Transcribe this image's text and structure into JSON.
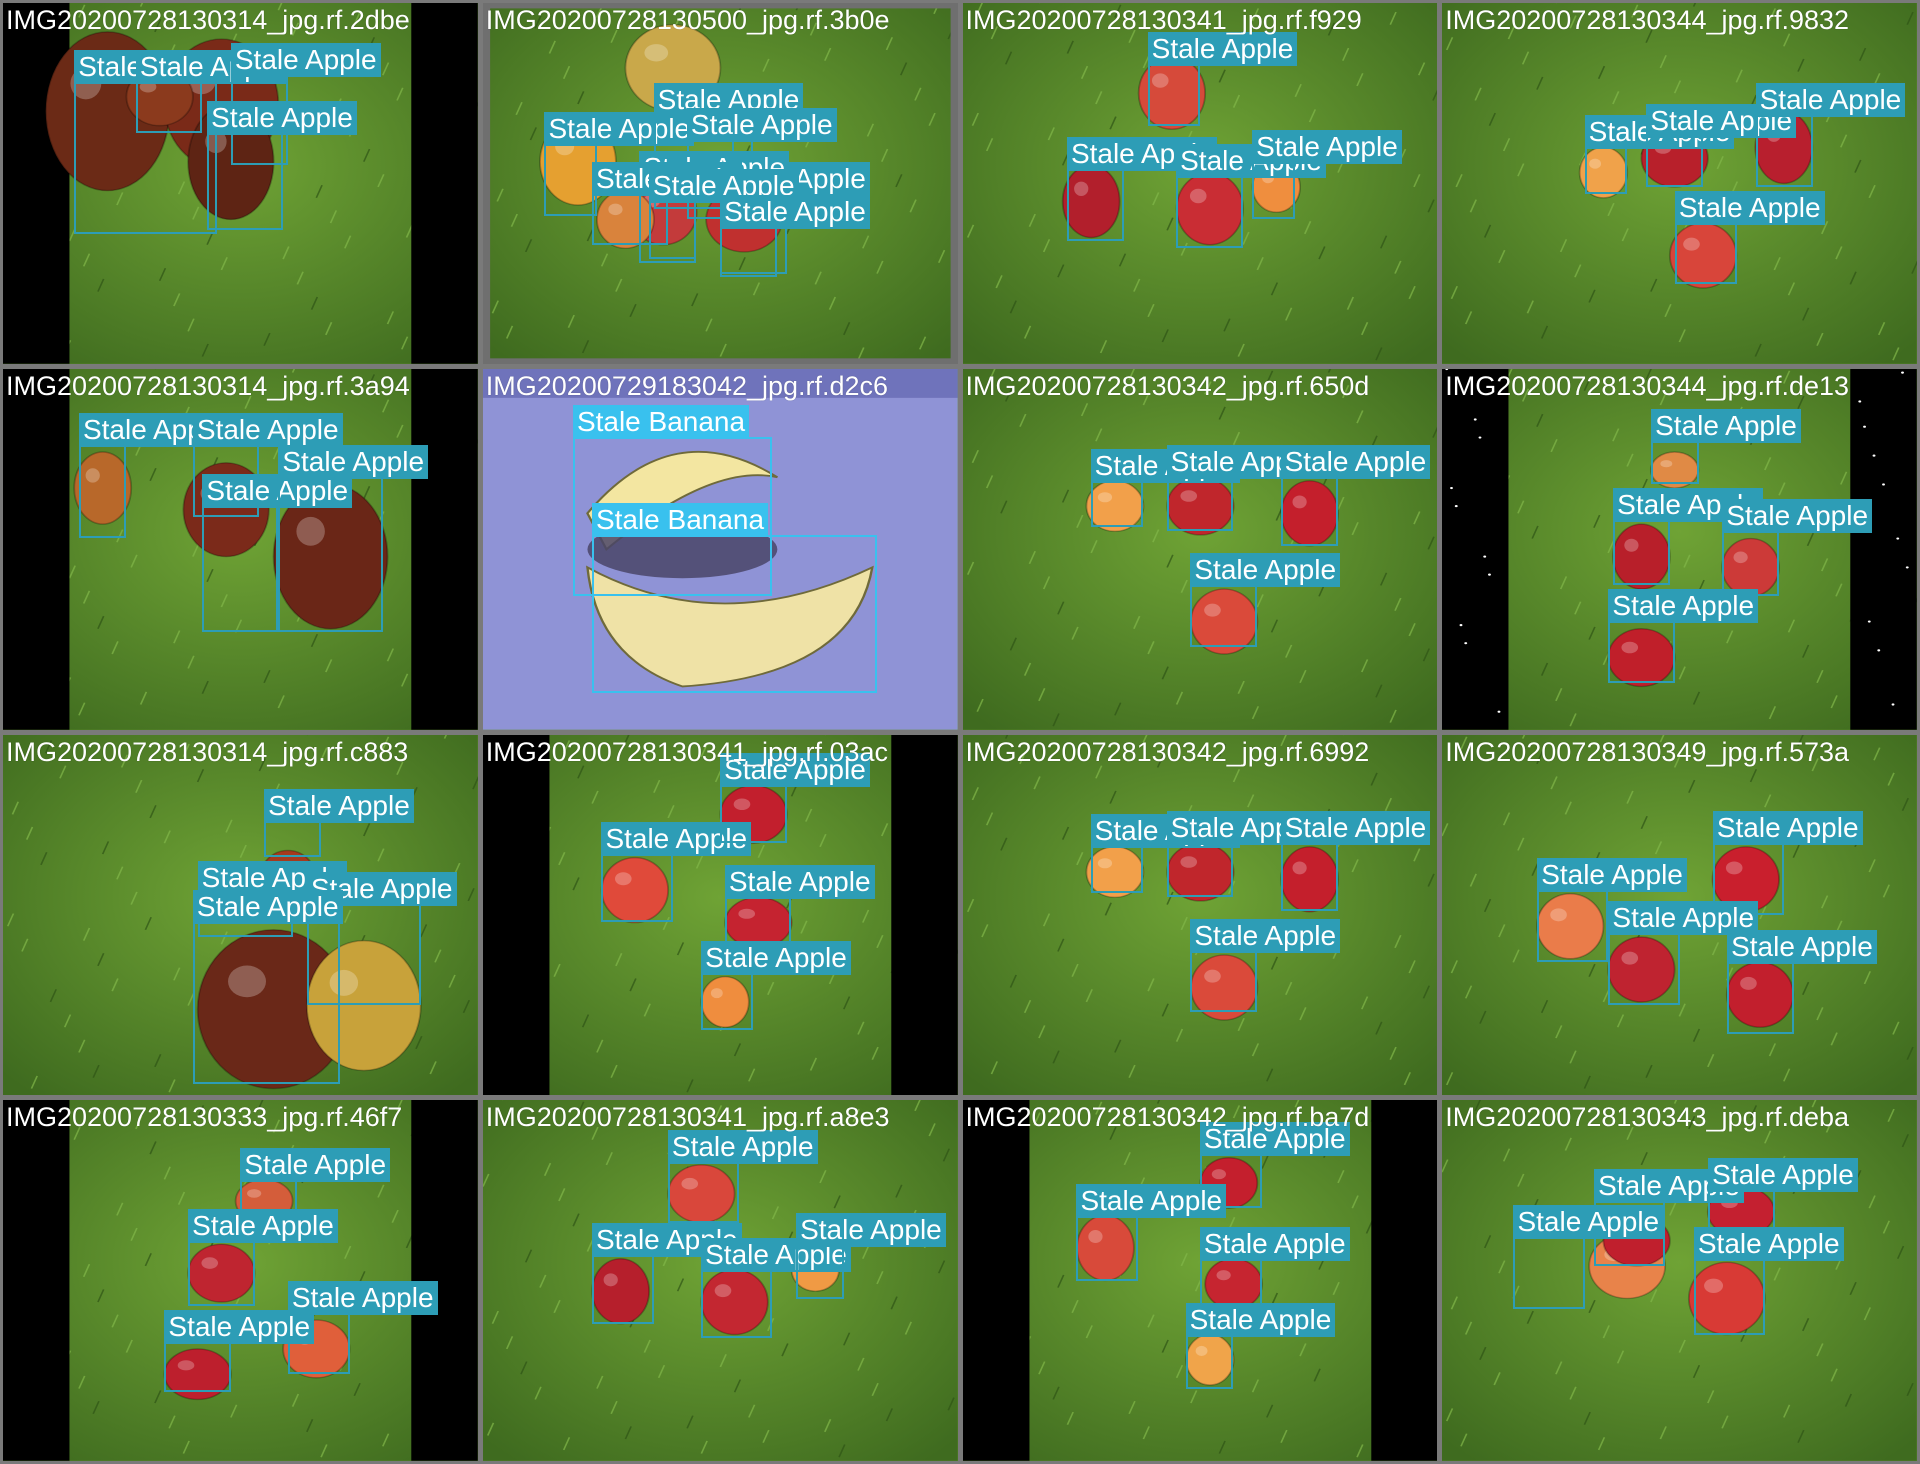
{
  "colors": {
    "frame_bg": "#7a7a7a",
    "apple_box": "#2d9db6",
    "banana_box": "#39c1ee",
    "grass": "#5e8f2a",
    "label_text": "#ffffff"
  },
  "grid": {
    "rows": 4,
    "cols": 4
  },
  "tiles": [
    {
      "filename": "IMG20200728130314_jpg.rf.2dbe",
      "scene": "grass-bars",
      "detections": [
        {
          "label": "Stale Apple",
          "kind": "apple"
        },
        {
          "label": "Stale Apple",
          "kind": "apple"
        },
        {
          "label": "Stale Apple",
          "kind": "apple"
        },
        {
          "label": "Stale Apple",
          "kind": "apple"
        }
      ]
    },
    {
      "filename": "IMG20200728130500_jpg.rf.3b0e",
      "scene": "grass-fisheye",
      "detections": [
        {
          "label": "Stale Apple",
          "kind": "apple"
        },
        {
          "label": "Stale Apple",
          "kind": "apple"
        },
        {
          "label": "Stale Apple",
          "kind": "apple"
        },
        {
          "label": "Stale Apple",
          "kind": "apple"
        },
        {
          "label": "Stale Apple",
          "kind": "apple"
        },
        {
          "label": "Stale Apple",
          "kind": "apple"
        },
        {
          "label": "Stale Apple",
          "kind": "apple"
        },
        {
          "label": "Stale Apple",
          "kind": "apple"
        }
      ]
    },
    {
      "filename": "IMG20200728130341_jpg.rf.f929",
      "scene": "grass",
      "detections": [
        {
          "label": "Stale Apple",
          "kind": "apple"
        },
        {
          "label": "Stale Apple",
          "kind": "apple"
        },
        {
          "label": "Stale Apple",
          "kind": "apple"
        },
        {
          "label": "Stale Apple",
          "kind": "apple"
        }
      ]
    },
    {
      "filename": "IMG20200728130344_jpg.rf.9832",
      "scene": "grass",
      "detections": [
        {
          "label": "Stale Apple",
          "kind": "apple"
        },
        {
          "label": "Stale Apple",
          "kind": "apple"
        },
        {
          "label": "Stale Apple",
          "kind": "apple"
        },
        {
          "label": "Stale Apple",
          "kind": "apple"
        }
      ]
    },
    {
      "filename": "IMG20200728130314_jpg.rf.3a94",
      "scene": "grass-bars",
      "detections": [
        {
          "label": "Stale Apple",
          "kind": "apple"
        },
        {
          "label": "Stale Apple",
          "kind": "apple"
        },
        {
          "label": "Stale Apple",
          "kind": "apple"
        },
        {
          "label": "Stale Apple",
          "kind": "apple"
        }
      ]
    },
    {
      "filename": "IMG20200729183042_jpg.rf.d2c6",
      "scene": "blue",
      "detections": [
        {
          "label": "Stale Banana",
          "kind": "banana"
        },
        {
          "label": "Stale Banana",
          "kind": "banana"
        }
      ]
    },
    {
      "filename": "IMG20200728130342_jpg.rf.650d",
      "scene": "grass",
      "detections": [
        {
          "label": "Stale Apple",
          "kind": "apple"
        },
        {
          "label": "Stale Apple",
          "kind": "apple"
        },
        {
          "label": "Stale Apple",
          "kind": "apple"
        },
        {
          "label": "Stale Apple",
          "kind": "apple"
        }
      ]
    },
    {
      "filename": "IMG20200728130344_jpg.rf.de13",
      "scene": "grass-bars-dark",
      "detections": [
        {
          "label": "Stale Apple",
          "kind": "apple"
        },
        {
          "label": "Stale Apple",
          "kind": "apple"
        },
        {
          "label": "Stale Apple",
          "kind": "apple"
        },
        {
          "label": "Stale Apple",
          "kind": "apple"
        }
      ]
    },
    {
      "filename": "IMG20200728130314_jpg.rf.c883",
      "scene": "grass",
      "detections": [
        {
          "label": "Stale Apple",
          "kind": "apple"
        },
        {
          "label": "Stale Apple",
          "kind": "apple"
        },
        {
          "label": "Stale Apple",
          "kind": "apple"
        },
        {
          "label": "Stale Apple",
          "kind": "apple"
        }
      ]
    },
    {
      "filename": "IMG20200728130341_jpg.rf.03ac",
      "scene": "grass-bars",
      "detections": [
        {
          "label": "Stale Apple",
          "kind": "apple"
        },
        {
          "label": "Stale Apple",
          "kind": "apple"
        },
        {
          "label": "Stale Apple",
          "kind": "apple"
        },
        {
          "label": "Stale Apple",
          "kind": "apple"
        }
      ]
    },
    {
      "filename": "IMG20200728130342_jpg.rf.6992",
      "scene": "grass",
      "detections": [
        {
          "label": "Stale Apple",
          "kind": "apple"
        },
        {
          "label": "Stale Apple",
          "kind": "apple"
        },
        {
          "label": "Stale Apple",
          "kind": "apple"
        },
        {
          "label": "Stale Apple",
          "kind": "apple"
        }
      ]
    },
    {
      "filename": "IMG20200728130349_jpg.rf.573a",
      "scene": "grass",
      "detections": [
        {
          "label": "Stale Apple",
          "kind": "apple"
        },
        {
          "label": "Stale Apple",
          "kind": "apple"
        },
        {
          "label": "Stale Apple",
          "kind": "apple"
        },
        {
          "label": "Stale Apple",
          "kind": "apple"
        }
      ]
    },
    {
      "filename": "IMG20200728130333_jpg.rf.46f7",
      "scene": "grass-bars",
      "detections": [
        {
          "label": "Stale Apple",
          "kind": "apple"
        },
        {
          "label": "Stale Apple",
          "kind": "apple"
        },
        {
          "label": "Stale Apple",
          "kind": "apple"
        },
        {
          "label": "Stale Apple",
          "kind": "apple"
        }
      ]
    },
    {
      "filename": "IMG20200728130341_jpg.rf.a8e3",
      "scene": "grass",
      "detections": [
        {
          "label": "Stale Apple",
          "kind": "apple"
        },
        {
          "label": "Stale Apple",
          "kind": "apple"
        },
        {
          "label": "Stale Apple",
          "kind": "apple"
        },
        {
          "label": "Stale Apple",
          "kind": "apple"
        }
      ]
    },
    {
      "filename": "IMG20200728130342_jpg.rf.ba7d",
      "scene": "grass-bars",
      "detections": [
        {
          "label": "Stale Apple",
          "kind": "apple"
        },
        {
          "label": "Stale Apple",
          "kind": "apple"
        },
        {
          "label": "Stale Apple",
          "kind": "apple"
        },
        {
          "label": "Stale Apple",
          "kind": "apple"
        }
      ]
    },
    {
      "filename": "IMG20200728130343_jpg.rf.deba",
      "scene": "grass",
      "detections": [
        {
          "label": "Stale Apple",
          "kind": "apple"
        },
        {
          "label": "Stale Apple",
          "kind": "apple"
        },
        {
          "label": "Stale Apple",
          "kind": "apple"
        },
        {
          "label": "Stale Apple",
          "kind": "apple"
        }
      ]
    }
  ]
}
